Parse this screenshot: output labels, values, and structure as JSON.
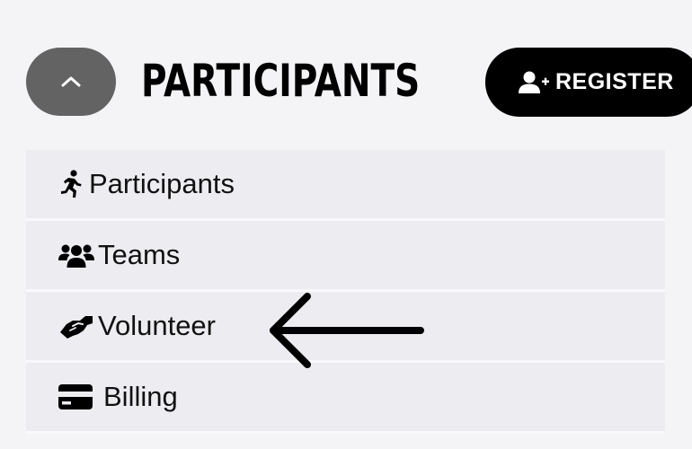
{
  "header": {
    "title": "PARTICIPANTS",
    "collapse_icon": "chevron-up-icon",
    "register": {
      "label": "REGISTER",
      "icon": "user-plus-icon"
    }
  },
  "menu": {
    "items": [
      {
        "label": "Participants",
        "icon": "running-icon"
      },
      {
        "label": "Teams",
        "icon": "users-icon"
      },
      {
        "label": "Volunteer",
        "icon": "handshake-icon"
      },
      {
        "label": "Billing",
        "icon": "credit-card-icon"
      }
    ]
  },
  "annotation": {
    "icon": "left-arrow-annotation",
    "color": "#000000"
  },
  "colors": {
    "background": "#f4f4f7",
    "menu_item_bg": "#ededf1",
    "collapse_button": "#636363",
    "register_button": "#000000",
    "text": "#111111"
  }
}
